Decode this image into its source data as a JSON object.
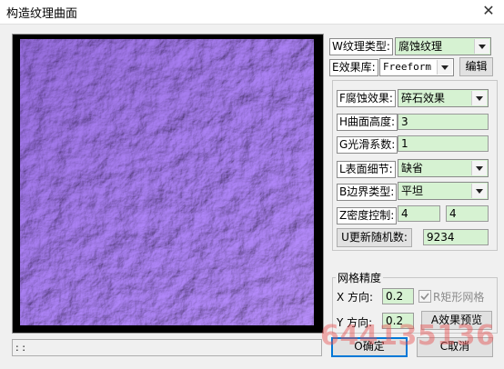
{
  "window": {
    "title": "构造纹理曲面",
    "close_glyph": "✕"
  },
  "texture_type": {
    "label": "W纹理类型:",
    "value": "腐蚀纹理"
  },
  "effect_library": {
    "label": "E效果库:",
    "value": "Freeform",
    "edit_button": "编辑"
  },
  "params": {
    "corrosion_effect": {
      "label": "F腐蚀效果:",
      "value": "碎石效果"
    },
    "surface_height": {
      "label": "H曲面高度:",
      "value": "3"
    },
    "smoothness": {
      "label": "G光滑系数:",
      "value": "1"
    },
    "surface_detail": {
      "label": "L表面细节:",
      "value": "缺省"
    },
    "border_type": {
      "label": "B边界类型:",
      "value": "平坦"
    },
    "density_control": {
      "label": "Z密度控制:",
      "value1": "4",
      "value2": "4"
    },
    "random_button": "U更新随机数:",
    "random_value": "9234"
  },
  "mesh": {
    "title": "网格精度",
    "x_label": "X 方向:",
    "x_value": "0.2",
    "y_label": "Y 方向:",
    "y_value": "0.2",
    "rect_mesh_label": "R矩形网格",
    "rect_mesh_checked": true,
    "preview_button": "A效果预览"
  },
  "buttons": {
    "ok": "O确定",
    "cancel": "C取消"
  },
  "status": {
    "text": ": :"
  },
  "watermark": "644135136",
  "colors": {
    "field_bg": "#d6f2d2",
    "texture_base": "#8f5fd0",
    "texture_dark": "#4a2a78"
  }
}
